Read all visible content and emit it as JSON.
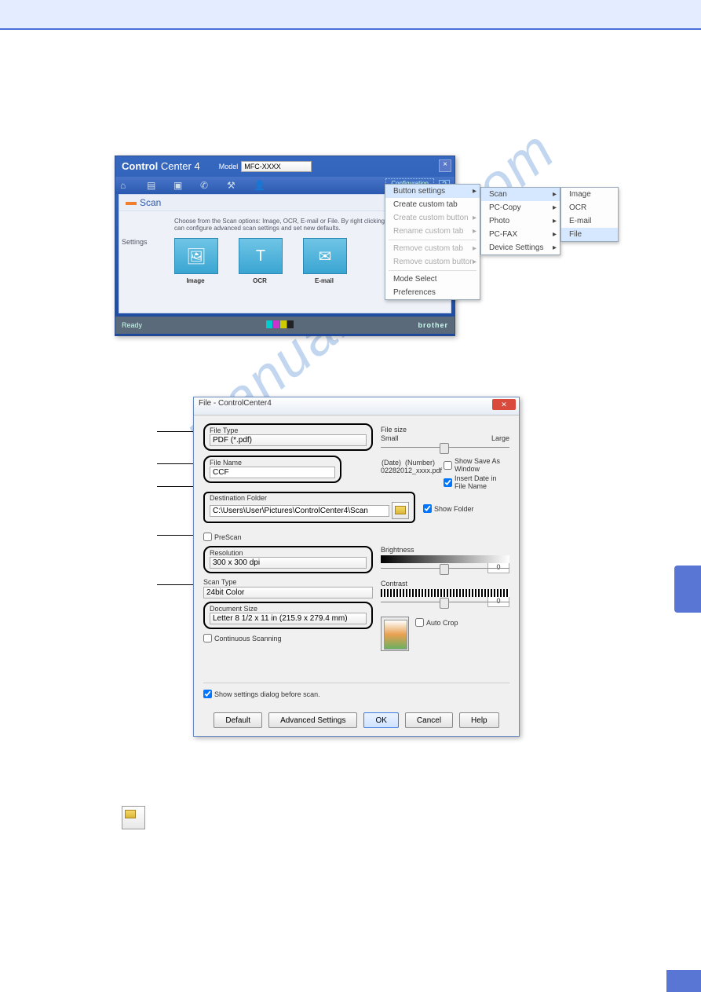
{
  "cc4": {
    "title_bold": "Control",
    "title_rest": " Center 4",
    "model_label": "Model",
    "model_value": "MFC-XXXX",
    "config_button": "Configuration",
    "scan_tab": "Scan",
    "settings_label": "Settings",
    "desc": "Choose from the Scan options: Image, OCR, E-mail or File. By right clicking on a button you can configure advanced scan settings and set new defaults.",
    "cards": [
      "Image",
      "OCR",
      "E-mail"
    ],
    "status": "Ready",
    "brand": "brother"
  },
  "menu1": {
    "items": [
      {
        "label": "Button settings",
        "arrow": true,
        "hl": true
      },
      {
        "label": "Create custom tab"
      },
      {
        "label": "Create custom button",
        "arrow": true,
        "dis": true
      },
      {
        "label": "Rename custom tab",
        "arrow": true,
        "dis": true
      },
      {
        "label": "Remove custom tab",
        "arrow": true,
        "dis": true
      },
      {
        "label": "Remove custom button",
        "arrow": true,
        "dis": true
      },
      {
        "label": "Mode Select"
      },
      {
        "label": "Preferences"
      }
    ]
  },
  "menu2": {
    "items": [
      {
        "label": "Scan",
        "arrow": true,
        "hl": true
      },
      {
        "label": "PC-Copy",
        "arrow": true
      },
      {
        "label": "Photo",
        "arrow": true
      },
      {
        "label": "PC-FAX",
        "arrow": true
      },
      {
        "label": "Device Settings",
        "arrow": true
      }
    ]
  },
  "menu3": {
    "items": [
      {
        "label": "Image"
      },
      {
        "label": "OCR"
      },
      {
        "label": "E-mail"
      },
      {
        "label": "File",
        "hl": true
      }
    ]
  },
  "dlg": {
    "title": "File - ControlCenter4",
    "file_type_label": "File Type",
    "file_type_value": "PDF (*.pdf)",
    "file_size_label": "File size",
    "file_size_small": "Small",
    "file_size_large": "Large",
    "file_name_label": "File Name",
    "file_name_value": "CCF",
    "date_label": "(Date)",
    "number_label": "(Number)",
    "filename_preview": "02282012_xxxx.pdf",
    "show_save": "Show Save As Window",
    "insert_date": "Insert Date in File Name",
    "dest_label": "Destination Folder",
    "dest_value": "C:\\Users\\User\\Pictures\\ControlCenter4\\Scan",
    "show_folder": "Show Folder",
    "prescan": "PreScan",
    "res_label": "Resolution",
    "res_value": "300 x 300 dpi",
    "scantype_label": "Scan Type",
    "scantype_value": "24bit Color",
    "docsize_label": "Document Size",
    "docsize_value": "Letter 8 1/2 x 11 in (215.9 x 279.4 mm)",
    "cont_scan": "Continuous Scanning",
    "brightness": "Brightness",
    "contrast": "Contrast",
    "brightness_val": "0",
    "contrast_val": "0",
    "autocrop": "Auto Crop",
    "show_before": "Show settings dialog before scan.",
    "btn_default": "Default",
    "btn_adv": "Advanced Settings",
    "btn_ok": "OK",
    "btn_cancel": "Cancel",
    "btn_help": "Help"
  },
  "watermark": "manualshive.com"
}
